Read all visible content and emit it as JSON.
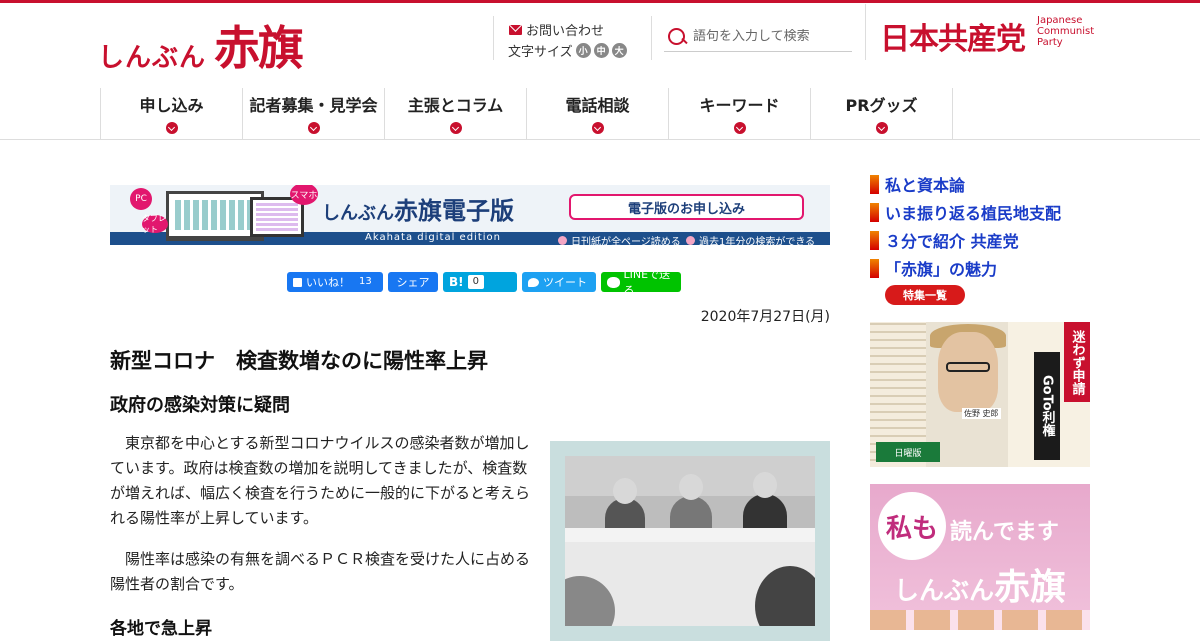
{
  "header": {
    "logo_kana": "しんぶん",
    "logo_main": "赤旗",
    "contact_label": "お問い合わせ",
    "fontsize_label": "文字サイズ",
    "fontsize_small": "小",
    "fontsize_medium": "中",
    "fontsize_large": "大",
    "search_placeholder": "語句を入力して検索",
    "party_name": "日本共産党",
    "party_en_1": "Japanese",
    "party_en_2": "Communist",
    "party_en_3": "Party"
  },
  "nav": {
    "items": [
      {
        "label": "申し込み"
      },
      {
        "label": "記者募集・見学会"
      },
      {
        "label": "主張とコラム"
      },
      {
        "label": "電話相談"
      },
      {
        "label": "キーワード"
      },
      {
        "label": "PRグッズ"
      }
    ]
  },
  "banner": {
    "pc": "PC",
    "tablet": "タブレット",
    "smartphone": "スマホ",
    "title_kana": "しんぶん",
    "title_main": "赤旗電子版",
    "subtitle": "Akahata digital edition",
    "cta": "電子版のお申し込み",
    "note_1": "日刊紙が全ページ読める",
    "note_2": "過去1年分の検索ができる"
  },
  "share": {
    "like_label": "いいね！",
    "like_count": "13",
    "share_label": "シェア",
    "hatena_label": "B!",
    "hatena_count": "0",
    "tweet_label": "ツイート",
    "line_label": "LINEで送る"
  },
  "article": {
    "date": "2020年7月27日(月)",
    "headline": "新型コロナ　検査数増なのに陽性率上昇",
    "subhead": "政府の感染対策に疑問",
    "paragraph_1": "東京都を中心とする新型コロナウイルスの感染者数が増加しています。政府は検査数の増加を説明してきましたが、検査数が増えれば、幅広く検査を行うために一般的に下がると考えられる陽性率が上昇しています。",
    "paragraph_2": "陽性率は感染の有無を調べるＰＣＲ検査を受けた人に占める陽性者の割合です。",
    "section_head": "各地で急上昇"
  },
  "sidebar": {
    "links": [
      {
        "label": "私と資本論"
      },
      {
        "label": "いま振り返る植民地支配"
      },
      {
        "label": "３分で紹介 共産党"
      },
      {
        "label": "「赤旗」の魅力"
      }
    ],
    "all_label": "特集一覧",
    "ad1": {
      "headline_1": "迷わず申請",
      "headline_2": "GoTo利権",
      "person_name": "佐野 史郎",
      "day_label": "日曜版"
    },
    "ad2": {
      "bubble": "私も",
      "text_1": "読んでます",
      "text_2_kana": "しんぶん",
      "text_2_main": "赤旗"
    }
  }
}
